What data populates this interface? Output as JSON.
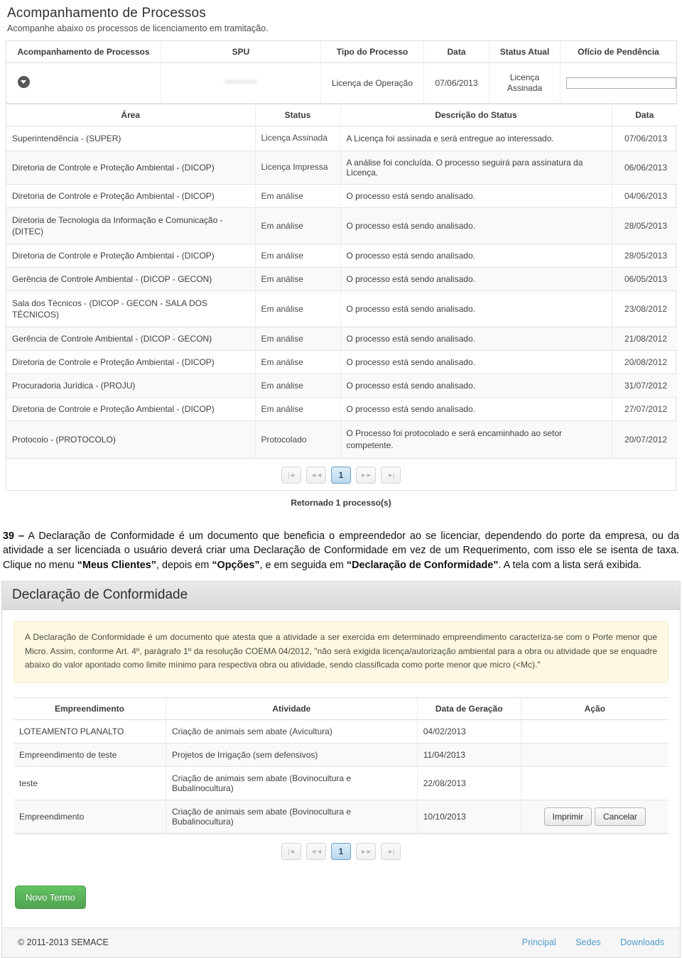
{
  "process_panel": {
    "title": "Acompanhamento de Processos",
    "subtitle": "Acompanhe abaixo os processos de licenciamento em tramitação.",
    "columns": [
      "Acompanhamento de Processos",
      "SPU",
      "Tipo do Processo",
      "Data",
      "Status Atual",
      "Ofício de Pendência"
    ],
    "row": {
      "expand_icon": "chevron-down-circle-icon",
      "spu": "********",
      "tipo": "Licença de Operação",
      "data": "07/06/2013",
      "status_atual": "Licença Assinada",
      "oficio_value": "",
      "oficio_placeholder": ""
    },
    "history": {
      "columns": [
        "Área",
        "Status",
        "Descrição do Status",
        "Data"
      ],
      "rows": [
        {
          "area": "Superintendência - (SUPER)",
          "status": "Licença Assinada",
          "desc": "A Licença foi assinada e será entregue ao interessado.",
          "data": "07/06/2013"
        },
        {
          "area": "Diretoria de Controle e Proteção Ambiental - (DICOP)",
          "status": "Licença Impressa",
          "desc": "A análise foi concluída. O processo seguirá para assinatura da Licença.",
          "data": "06/06/2013"
        },
        {
          "area": "Diretoria de Controle e Proteção Ambiental - (DICOP)",
          "status": "Em análise",
          "desc": "O processo está sendo analisado.",
          "data": "04/06/2013"
        },
        {
          "area": "Diretoria de Tecnologia da Informação e Comunicação - (DITEC)",
          "status": "Em análise",
          "desc": "O processo está sendo analisado.",
          "data": "28/05/2013"
        },
        {
          "area": "Diretoria de Controle e Proteção Ambiental - (DICOP)",
          "status": "Em análise",
          "desc": "O processo está sendo analisado.",
          "data": "28/05/2013"
        },
        {
          "area": "Gerência de Controle Ambiental - (DICOP - GECON)",
          "status": "Em análise",
          "desc": "O processo está sendo analisado.",
          "data": "06/05/2013"
        },
        {
          "area": "Sala dos Técnicos - (DICOP - GECON - SALA DOS TÉCNICOS)",
          "status": "Em análise",
          "desc": "O processo está sendo analisado.",
          "data": "23/08/2012"
        },
        {
          "area": "Gerência de Controle Ambiental - (DICOP - GECON)",
          "status": "Em análise",
          "desc": "O processo está sendo analisado.",
          "data": "21/08/2012"
        },
        {
          "area": "Diretoria de Controle e Proteção Ambiental - (DICOP)",
          "status": "Em análise",
          "desc": "O processo está sendo analisado.",
          "data": "20/08/2012"
        },
        {
          "area": "Procuradoria Jurídica - (PROJU)",
          "status": "Em análise",
          "desc": "O processo está sendo analisado.",
          "data": "31/07/2012"
        },
        {
          "area": "Diretoria de Controle e Proteção Ambiental - (DICOP)",
          "status": "Em análise",
          "desc": "O processo está sendo analisado.",
          "data": "27/07/2012"
        },
        {
          "area": "Protocolo - (PROTOCOLO)",
          "status": "Protocolado",
          "desc": "O Processo foi protocolado e será encaminhado ao setor competente.",
          "data": "20/07/2012"
        }
      ]
    },
    "pager": {
      "first": "|◄",
      "prev": "◄◄",
      "current": "1",
      "next": "►►",
      "last": "►|"
    },
    "returned_text": "Retornado 1 processo(s)"
  },
  "narrative": {
    "number": "39 –",
    "part1": " A Declaração de Conformidade é um documento que beneficia o empreendedor ao se licenciar, dependendo do porte da empresa, ou da atividade a ser licenciada o usuário deverá criar uma Declaração de Conformidade em vez de um Requerimento, com isso ele se isenta de taxa. Clique no menu ",
    "bold1": "“Meus Clientes”",
    "part2": ", depois em ",
    "bold2": "“Opções”",
    "part3": ", e em seguida em ",
    "bold3": "“Declaração de Conformidade”",
    "part4": ". A tela com a lista será exibida."
  },
  "dc_panel": {
    "title": "Declaração de Conformidade",
    "alert": "A Declaração de Conformidade é um documento que atesta que a atividade a ser exercida em determinado empreendimento caracteriza-se com o Porte menor que Micro. Assim, conforme Art. 4º, parágrafo 1º da resolução COEMA 04/2012, \"não será exigida licença/autorização ambiental para a obra ou atividade que se enquadre abaixo do valor apontado como limite mínimo para respectiva obra ou atividade, sendo classificada como porte menor que micro (<Mc).\"",
    "columns": [
      "Empreendimento",
      "Atividade",
      "Data de Geração",
      "Ação"
    ],
    "rows": [
      {
        "empreendimento": "LOTEAMENTO PLANALTO",
        "atividade": "Criação de animais sem abate (Avicultura)",
        "data": "04/02/2013",
        "actions": []
      },
      {
        "empreendimento": "Empreendimento de teste",
        "atividade": "Projetos de Irrigação (sem defensivos)",
        "data": "11/04/2013",
        "actions": []
      },
      {
        "empreendimento": "teste",
        "atividade": "Criação de animais sem abate (Bovinocultura e Bubalinocultura)",
        "data": "22/08/2013",
        "actions": []
      },
      {
        "empreendimento": "Empreendimento",
        "atividade": "Criação de animais sem abate (Bovinocultura e Bubalinocultura)",
        "data": "10/10/2013",
        "actions": [
          "Imprimir",
          "Cancelar"
        ]
      }
    ],
    "pager": {
      "first": "|◄",
      "prev": "◄◄",
      "current": "1",
      "next": "►►",
      "last": "►|"
    },
    "new_term_label": "Novo Termo"
  },
  "footer": {
    "copyright": "© 2011-2013 SEMACE",
    "links": [
      "Principal",
      "Sedes",
      "Downloads"
    ]
  },
  "colors": {
    "accent_link": "#4e9ccd",
    "green_button": "#51a351",
    "alert_bg": "#fcf8e3",
    "row_alt": "#f7f9fb",
    "pager_active": "#b9d9ef"
  }
}
